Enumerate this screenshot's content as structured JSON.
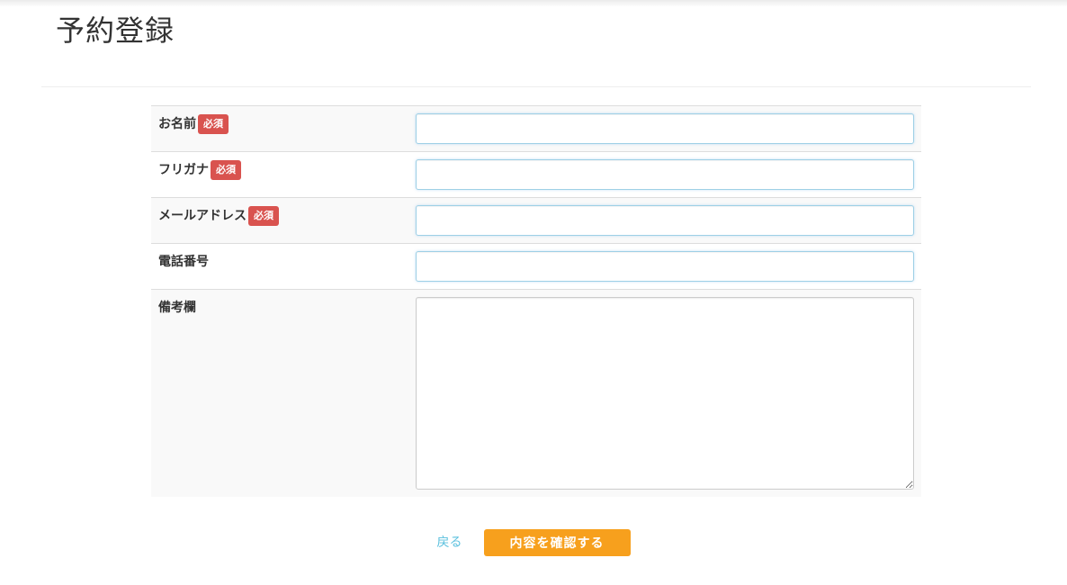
{
  "page": {
    "title": "予約登録"
  },
  "form": {
    "required_label": "必須",
    "fields": [
      {
        "label": "お名前",
        "required": true,
        "value": "",
        "placeholder": ""
      },
      {
        "label": "フリガナ",
        "required": true,
        "value": "",
        "placeholder": ""
      },
      {
        "label": "メールアドレス",
        "required": true,
        "value": "",
        "placeholder": ""
      },
      {
        "label": "電話番号",
        "required": false,
        "value": "",
        "placeholder": ""
      },
      {
        "label": "備考欄",
        "required": false,
        "value": "",
        "placeholder": ""
      }
    ]
  },
  "actions": {
    "back_label": "戻る",
    "confirm_label": "内容を確認する"
  },
  "colors": {
    "required_badge": "#d9534f",
    "confirm_button": "#f7a01d",
    "back_link": "#5bc0de"
  }
}
